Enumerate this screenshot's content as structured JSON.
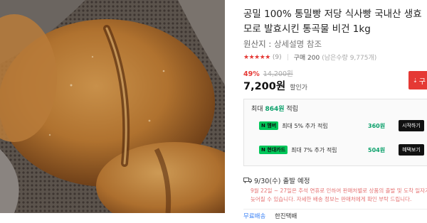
{
  "product": {
    "title_line1": "공밀 100% 통밀빵 저당 식사빵 국내산 생효",
    "title_line2": "모로 발효시킨 통곡물 비건 1kg",
    "origin_label": "원산지 :",
    "origin_value": "상세설명 참조",
    "stars": "★★★★★",
    "review_count": "(9)",
    "purchase_count": "구매 200",
    "stock": "(남은수량 9,775개)",
    "discount_rate": "49%",
    "original_price": "14,200원",
    "price": "7,200원",
    "price_tag": "할인가",
    "buy_label": "구"
  },
  "points": {
    "max_prefix": "최대",
    "max_amount": "864원",
    "max_suffix": "적립",
    "cards": [
      {
        "badge": "N 멤버",
        "desc": "최대 5% 추가 적립",
        "amount": "360원",
        "action": "시작하기"
      },
      {
        "badge": "N 현대카드",
        "desc": "최대 7% 추가 적립",
        "amount": "504원",
        "action": "혜택보기"
      }
    ]
  },
  "shipping": {
    "expected": "9/30(수) 출발 예정",
    "note_line1": "9월 22일 ~ 27일은 추석 연휴로 인하여 판매처별로 상품의 출발 및 도착 일자가",
    "note_line2": "늦어질 수 있습니다. 자세한 배송 정보는 판매처에게 확인 부탁 드립니다.",
    "fee": "무료배송",
    "carrier": "한진택배"
  },
  "colors": {
    "accent_red": "#e53935",
    "point_green": "#02c75a"
  }
}
